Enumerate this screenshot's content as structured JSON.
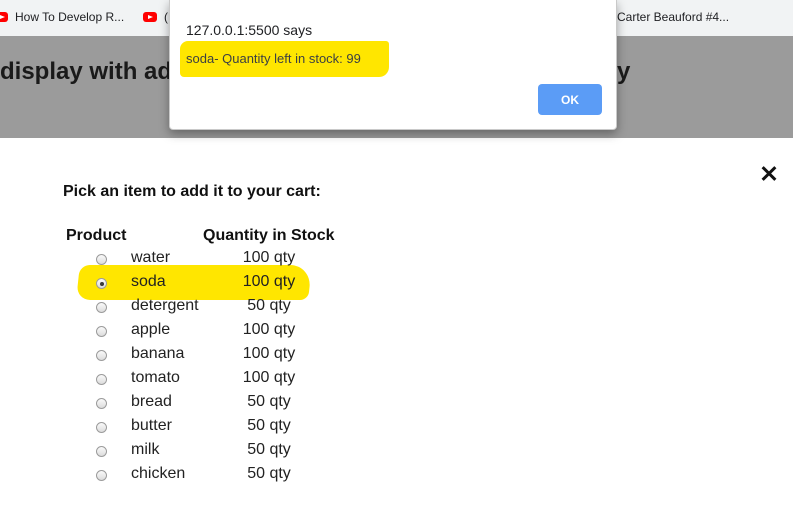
{
  "bookmarks": {
    "items": [
      {
        "label": "How To Develop R..."
      },
      {
        "label": "("
      },
      {
        "label": "Carter Beauford #4..."
      }
    ]
  },
  "header": {
    "title_left": "display with add",
    "title_right": "y"
  },
  "alert": {
    "origin": "127.0.0.1:5500 says",
    "message": "soda- Quantity left in stock: 99",
    "ok_label": "OK"
  },
  "modal": {
    "instruction": "Pick an item to add it to your cart:",
    "columns": [
      "Product",
      "Quantity in Stock"
    ],
    "selected_index": 1,
    "rows": [
      {
        "product": "water",
        "quantity": "100 qty"
      },
      {
        "product": "soda",
        "quantity": "100 qty"
      },
      {
        "product": "detergent",
        "quantity": "50 qty"
      },
      {
        "product": "apple",
        "quantity": "100 qty"
      },
      {
        "product": "banana",
        "quantity": "100 qty"
      },
      {
        "product": "tomato",
        "quantity": "100 qty"
      },
      {
        "product": "bread",
        "quantity": "50 qty"
      },
      {
        "product": "butter",
        "quantity": "50 qty"
      },
      {
        "product": "milk",
        "quantity": "50 qty"
      },
      {
        "product": "chicken",
        "quantity": "50 qty"
      }
    ]
  },
  "colors": {
    "highlight": "#ffe600",
    "ok_button": "#5b9cf6",
    "header_background": "#9b9b9b"
  },
  "icons": [
    "youtube-icon",
    "close-icon"
  ]
}
